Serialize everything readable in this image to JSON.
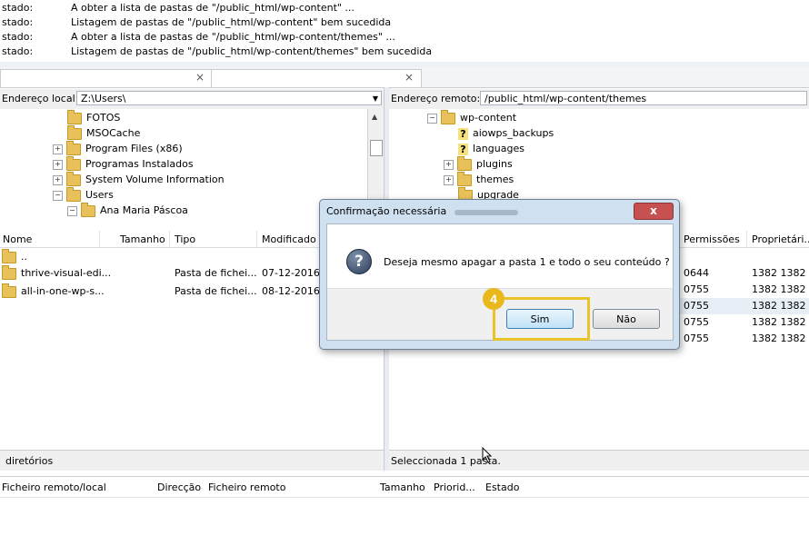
{
  "log": [
    {
      "key": "stado:",
      "text": "A obter a lista de pastas de \"/public_html/wp-content\" ..."
    },
    {
      "key": "stado:",
      "text": "Listagem de pastas de \"/public_html/wp-content\" bem sucedida"
    },
    {
      "key": "stado:",
      "text": "A obter a lista de pastas de \"/public_html/wp-content/themes\" ..."
    },
    {
      "key": "stado:",
      "text": "Listagem de pastas de \"/public_html/wp-content/themes\" bem sucedida"
    }
  ],
  "tabs": {
    "close_glyph": "×"
  },
  "local": {
    "address_label": "Endereço local:",
    "address_value": "Z:\\Users\\",
    "tree": [
      "FOTOS",
      "MSOCache",
      "Program Files (x86)",
      "Programas Instalados",
      "System Volume Information",
      "Users",
      "Ana Maria Páscoa"
    ],
    "columns": [
      "Nome",
      "Tamanho",
      "Tipo",
      "Modificado"
    ],
    "files": [
      {
        "name": "..",
        "type": "",
        "modified": ""
      },
      {
        "name": "thrive-visual-edi...",
        "type": "Pasta de fichei...",
        "modified": "07-12-2016 0"
      },
      {
        "name": "all-in-one-wp-s...",
        "type": "Pasta de fichei...",
        "modified": "08-12-2016 0"
      }
    ],
    "status": "diretórios"
  },
  "remote": {
    "address_label": "Endereço remoto:",
    "address_value": "/public_html/wp-content/themes",
    "tree": [
      "wp-content",
      "aiowps_backups",
      "languages",
      "plugins",
      "themes",
      "upgrade"
    ],
    "columns": [
      "Permissões",
      "Proprietári..."
    ],
    "rows": [
      {
        "perm": "0644",
        "owner": "1382 1382"
      },
      {
        "perm": "0755",
        "owner": "1382 1382"
      },
      {
        "perm": "0755",
        "owner": "1382 1382"
      },
      {
        "perm": "0755",
        "owner": "1382 1382"
      },
      {
        "perm": "0755",
        "owner": "1382 1382"
      }
    ],
    "status": "Seleccionada 1 pasta."
  },
  "queue": {
    "columns": [
      "Ficheiro remoto/local",
      "Direcção",
      "Ficheiro remoto",
      "Tamanho",
      "Priorid...",
      "Estado"
    ]
  },
  "dialog": {
    "title": "Confirmação necessária",
    "message": "Deseja mesmo apagar a pasta 1 e todo o seu conteúdo ?",
    "yes_label": "Sim",
    "no_label": "Não",
    "close_glyph": "x",
    "icon": "question-icon"
  },
  "annotation": {
    "step": "4",
    "color": "#e8c32a"
  }
}
